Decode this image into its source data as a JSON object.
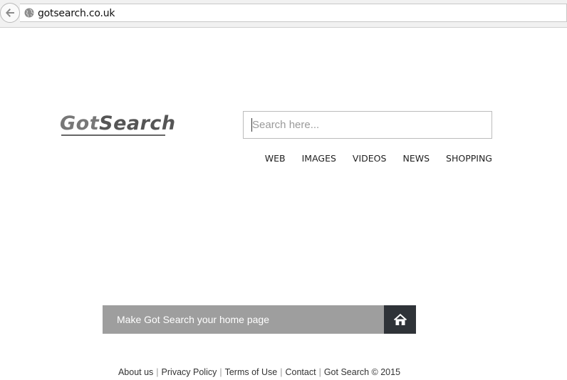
{
  "browser": {
    "url": "gotsearch.co.uk"
  },
  "logo": {
    "part1": "Got",
    "part2": "Search"
  },
  "search": {
    "placeholder": "Search here..."
  },
  "nav": [
    {
      "label": "WEB"
    },
    {
      "label": "IMAGES"
    },
    {
      "label": "VIDEOS"
    },
    {
      "label": "NEWS"
    },
    {
      "label": "SHOPPING"
    }
  ],
  "homepage_banner": {
    "label": "Make Got Search your home page",
    "icon": "home-icon"
  },
  "footer": {
    "about": "About us",
    "privacy": "Privacy Policy",
    "terms": "Terms of Use",
    "contact": "Contact",
    "copyright": "Got Search © 2015",
    "separator": "|"
  },
  "colors": {
    "banner_bg": "#9e9e9e",
    "banner_icon_bg": "#2f3338"
  }
}
